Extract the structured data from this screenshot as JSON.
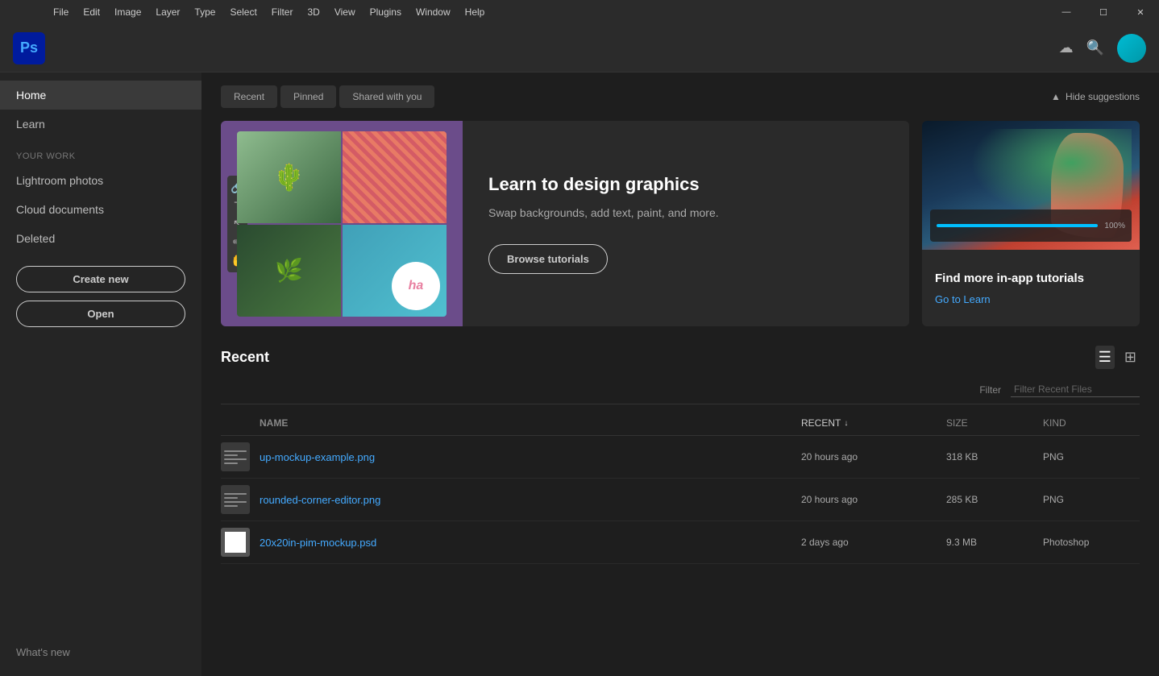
{
  "titlebar": {
    "menu_items": [
      "File",
      "Edit",
      "Image",
      "Layer",
      "Type",
      "Select",
      "Filter",
      "3D",
      "View",
      "Plugins",
      "Window",
      "Help"
    ],
    "window_controls": [
      "—",
      "☐",
      "✕"
    ]
  },
  "header": {
    "app_name": "Ps",
    "cloud_icon": "☁",
    "search_icon": "🔍"
  },
  "sidebar": {
    "nav_items": [
      {
        "label": "Home",
        "active": true
      },
      {
        "label": "Learn",
        "active": false
      }
    ],
    "section_label": "YOUR WORK",
    "work_items": [
      {
        "label": "Lightroom photos"
      },
      {
        "label": "Cloud documents"
      },
      {
        "label": "Deleted"
      }
    ],
    "create_button": "Create new",
    "open_button": "Open",
    "bottom_items": [
      {
        "label": "What's new"
      }
    ]
  },
  "tabs": [
    {
      "label": "Recent"
    },
    {
      "label": "Pinned"
    },
    {
      "label": "Shared with you"
    }
  ],
  "hide_suggestions": "Hide suggestions",
  "tutorial_card": {
    "title": "Learn to design graphics",
    "description": "Swap backgrounds, add text, paint, and more.",
    "browse_button": "Browse tutorials"
  },
  "tutorials_find_card": {
    "title": "Find more in-app tutorials",
    "go_to_learn": "Go to Learn"
  },
  "recent": {
    "title": "Recent",
    "filter_label": "Filter",
    "filter_placeholder": "Filter Recent Files",
    "columns": {
      "name": "NAME",
      "recent": "RECENT",
      "size": "SIZE",
      "kind": "KIND"
    },
    "files": [
      {
        "name": "up-mockup-example.png",
        "recent": "20 hours ago",
        "size": "318 KB",
        "kind": "PNG",
        "thumb_type": "lines"
      },
      {
        "name": "rounded-corner-editor.png",
        "recent": "20 hours ago",
        "size": "285 KB",
        "kind": "PNG",
        "thumb_type": "lines"
      },
      {
        "name": "20x20in-pim-mockup.psd",
        "recent": "2 days ago",
        "size": "9.3 MB",
        "kind": "Photoshop",
        "thumb_type": "white"
      }
    ]
  }
}
